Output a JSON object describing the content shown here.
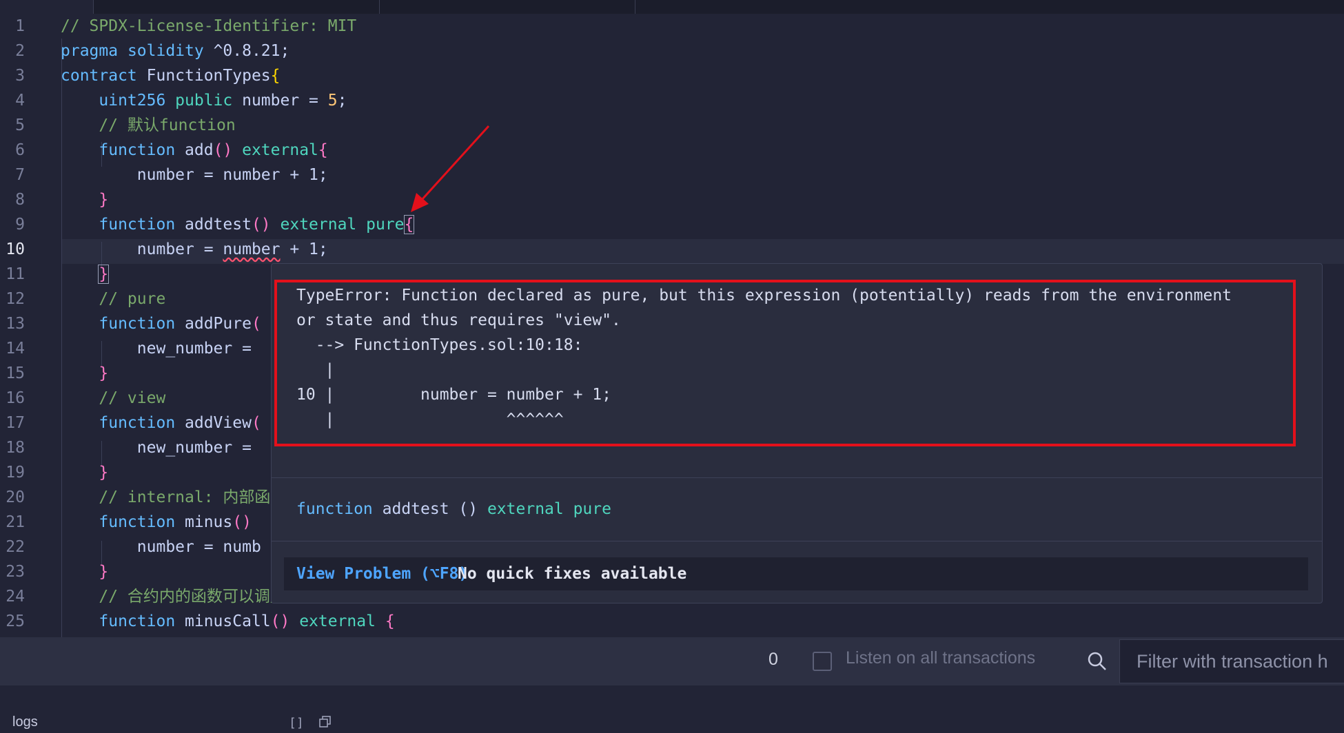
{
  "editor": {
    "active_line": 10,
    "lines": [
      [
        {
          "t": "// SPDX-License-Identifier: MIT",
          "c": "cm"
        }
      ],
      [
        {
          "t": "pragma ",
          "c": "kw"
        },
        {
          "t": "solidity ",
          "c": "kw"
        },
        {
          "t": "^0.8.21;",
          "c": "plain"
        }
      ],
      [
        {
          "t": "contract ",
          "c": "kw"
        },
        {
          "t": "FunctionTypes",
          "c": "fn"
        },
        {
          "t": "{",
          "c": "br2"
        }
      ],
      [
        {
          "t": "    "
        },
        {
          "t": "uint256 ",
          "c": "kw"
        },
        {
          "t": "public ",
          "c": "mod"
        },
        {
          "t": "number = ",
          "c": "plain"
        },
        {
          "t": "5",
          "c": "num"
        },
        {
          "t": ";",
          "c": "plain"
        }
      ],
      [
        {
          "t": "    "
        },
        {
          "t": "// 默认function",
          "c": "cm"
        }
      ],
      [
        {
          "t": "    "
        },
        {
          "t": "function ",
          "c": "kw"
        },
        {
          "t": "add",
          "c": "fn"
        },
        {
          "t": "()",
          "c": "br"
        },
        {
          "t": " external",
          "c": "mod"
        },
        {
          "t": "{",
          "c": "br"
        }
      ],
      [
        {
          "t": "        number = number + 1;",
          "c": "plain"
        }
      ],
      [
        {
          "t": "    "
        },
        {
          "t": "}",
          "c": "br"
        }
      ],
      [
        {
          "t": "    "
        },
        {
          "t": "function ",
          "c": "kw"
        },
        {
          "t": "addtest",
          "c": "fn"
        },
        {
          "t": "()",
          "c": "br"
        },
        {
          "t": " external ",
          "c": "mod"
        },
        {
          "t": "pure",
          "c": "mod"
        },
        {
          "t": "{",
          "c": "br bracket-box"
        }
      ],
      [
        {
          "t": "        number = ",
          "c": "plain"
        },
        {
          "t": "number",
          "c": "plain squig"
        },
        {
          "t": " + 1;",
          "c": "plain"
        }
      ],
      [
        {
          "t": "    "
        },
        {
          "t": "}",
          "c": "br bracket-box"
        }
      ],
      [
        {
          "t": "    "
        },
        {
          "t": "// pure",
          "c": "cm"
        }
      ],
      [
        {
          "t": "    "
        },
        {
          "t": "function ",
          "c": "kw"
        },
        {
          "t": "addPure",
          "c": "fn"
        },
        {
          "t": "(",
          "c": "br"
        }
      ],
      [
        {
          "t": "        new_number = ",
          "c": "plain"
        }
      ],
      [
        {
          "t": "    "
        },
        {
          "t": "}",
          "c": "br"
        }
      ],
      [
        {
          "t": "    "
        },
        {
          "t": "// view",
          "c": "cm"
        }
      ],
      [
        {
          "t": "    "
        },
        {
          "t": "function ",
          "c": "kw"
        },
        {
          "t": "addView",
          "c": "fn"
        },
        {
          "t": "(",
          "c": "br"
        }
      ],
      [
        {
          "t": "        new_number = ",
          "c": "plain"
        }
      ],
      [
        {
          "t": "    "
        },
        {
          "t": "}",
          "c": "br"
        }
      ],
      [
        {
          "t": "    "
        },
        {
          "t": "// internal: 内部函",
          "c": "cm"
        }
      ],
      [
        {
          "t": "    "
        },
        {
          "t": "function ",
          "c": "kw"
        },
        {
          "t": "minus",
          "c": "fn"
        },
        {
          "t": "()",
          "c": "br"
        }
      ],
      [
        {
          "t": "        number = numb",
          "c": "plain"
        }
      ],
      [
        {
          "t": "    "
        },
        {
          "t": "}",
          "c": "br"
        }
      ],
      [
        {
          "t": "    "
        },
        {
          "t": "// 合约内的函数可以调用内部函数",
          "c": "cm"
        }
      ],
      [
        {
          "t": "    "
        },
        {
          "t": "function ",
          "c": "kw"
        },
        {
          "t": "minusCall",
          "c": "fn"
        },
        {
          "t": "()",
          "c": "br"
        },
        {
          "t": " external ",
          "c": "mod"
        },
        {
          "t": "{",
          "c": "br"
        }
      ]
    ]
  },
  "hover": {
    "error_text": "TypeError: Function declared as pure, but this expression (potentially) reads from the environment\nor state and thus requires \"view\".\n  --> FunctionTypes.sol:10:18:\n   |\n10 |         number = number + 1;\n   |                  ^^^^^^",
    "signature": [
      {
        "t": "function ",
        "c": "kw"
      },
      {
        "t": "addtest ",
        "c": "fn"
      },
      {
        "t": "() ",
        "c": "plain"
      },
      {
        "t": "external ",
        "c": "mod"
      },
      {
        "t": "pure",
        "c": "mod"
      }
    ],
    "view_problem_label": "View Problem (⌥F8)",
    "no_fix_label": "No quick fixes available"
  },
  "filterbar": {
    "count": "0",
    "listen_label": "Listen on all transactions",
    "filter_placeholder": "Filter with transaction h"
  },
  "bottom": {
    "logs_label": "logs",
    "bracket_icon": "[]",
    "copy_icon": "copy-icon"
  },
  "colors": {
    "background": "#222436",
    "error_box": "#e3101b",
    "link": "#4ea5ff"
  }
}
